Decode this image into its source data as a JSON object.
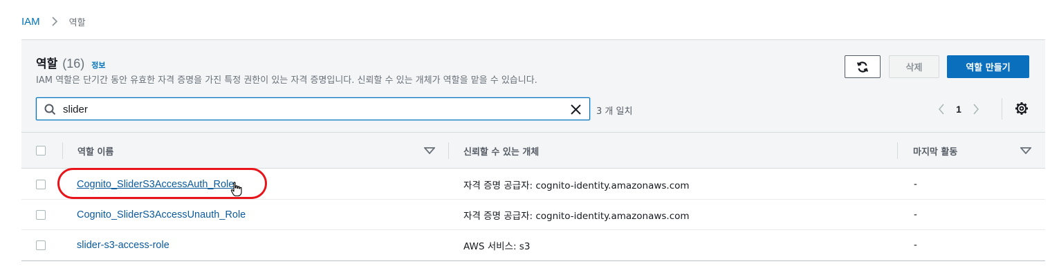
{
  "breadcrumb": {
    "root": "IAM",
    "current": "역할"
  },
  "header": {
    "title": "역할",
    "count": "(16)",
    "info": "정보",
    "description": "IAM 역할은 단기간 동안 유효한 자격 증명을 가진 특정 권한이 있는 자격 증명입니다. 신뢰할 수 있는 개체가 역할을 맡을 수 있습니다."
  },
  "toolbar": {
    "refresh_icon": "refresh-icon",
    "delete_label": "삭제",
    "create_label": "역할 만들기"
  },
  "search": {
    "value": "slider",
    "placeholder": "",
    "match_count": "3 개 일치"
  },
  "pagination": {
    "current_page": "1"
  },
  "table": {
    "columns": [
      "역할 이름",
      "신뢰할 수 있는 개체",
      "마지막 활동"
    ],
    "rows": [
      {
        "name": "Cognito_SliderS3AccessAuth_Role",
        "trusted": "자격 증명 공급자: cognito-identity.amazonaws.com",
        "last_activity": "-"
      },
      {
        "name": "Cognito_SliderS3AccessUnauth_Role",
        "trusted": "자격 증명 공급자: cognito-identity.amazonaws.com",
        "last_activity": "-"
      },
      {
        "name": "slider-s3-access-role",
        "trusted": "AWS 서비스: s3",
        "last_activity": "-"
      }
    ]
  },
  "colors": {
    "accent": "#0a6fbd",
    "link": "#0073bb",
    "highlight": "#e8141a"
  }
}
